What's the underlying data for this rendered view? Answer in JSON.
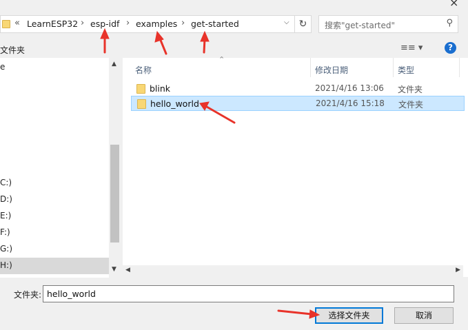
{
  "window": {
    "close_glyph": "×"
  },
  "address_bar": {
    "overflow_glyph": "«",
    "segments": [
      "LearnESP32",
      "esp-idf",
      "examples",
      "get-started"
    ],
    "separator": "›"
  },
  "search": {
    "placeholder": "搜索\"get-started\""
  },
  "toolbar": {
    "new_folder_label": "文件夹"
  },
  "nav_pane": {
    "items": [
      "e",
      "C:)",
      "D:)",
      "E:)",
      "F:)",
      "G:)",
      "H:)"
    ],
    "selected": "H:)"
  },
  "file_list": {
    "columns": {
      "name": "名称",
      "date": "修改日期",
      "type": "类型"
    },
    "rows": [
      {
        "name": "blink",
        "date": "2021/4/16 13:06",
        "type": "文件夹",
        "selected": false
      },
      {
        "name": "hello_world",
        "date": "2021/4/16 15:18",
        "type": "文件夹",
        "selected": true
      }
    ]
  },
  "footer": {
    "field_label": "文件夹:",
    "field_value": "hello_world",
    "select_button": "选择文件夹",
    "cancel_button": "取消"
  },
  "colors": {
    "selection_bg": "#cce8ff",
    "selection_border": "#99d1ff",
    "annotation_arrow": "#e8332a",
    "folder_yellow": "#f8d775",
    "help_blue": "#1a6ecf",
    "focus_border": "#0078d7"
  },
  "icons": [
    "folder-icon",
    "chevron-down-icon",
    "refresh-icon",
    "search-icon",
    "view-options-icon",
    "help-icon",
    "close-icon",
    "sort-arrow-icon",
    "scroll-arrow-icon"
  ]
}
